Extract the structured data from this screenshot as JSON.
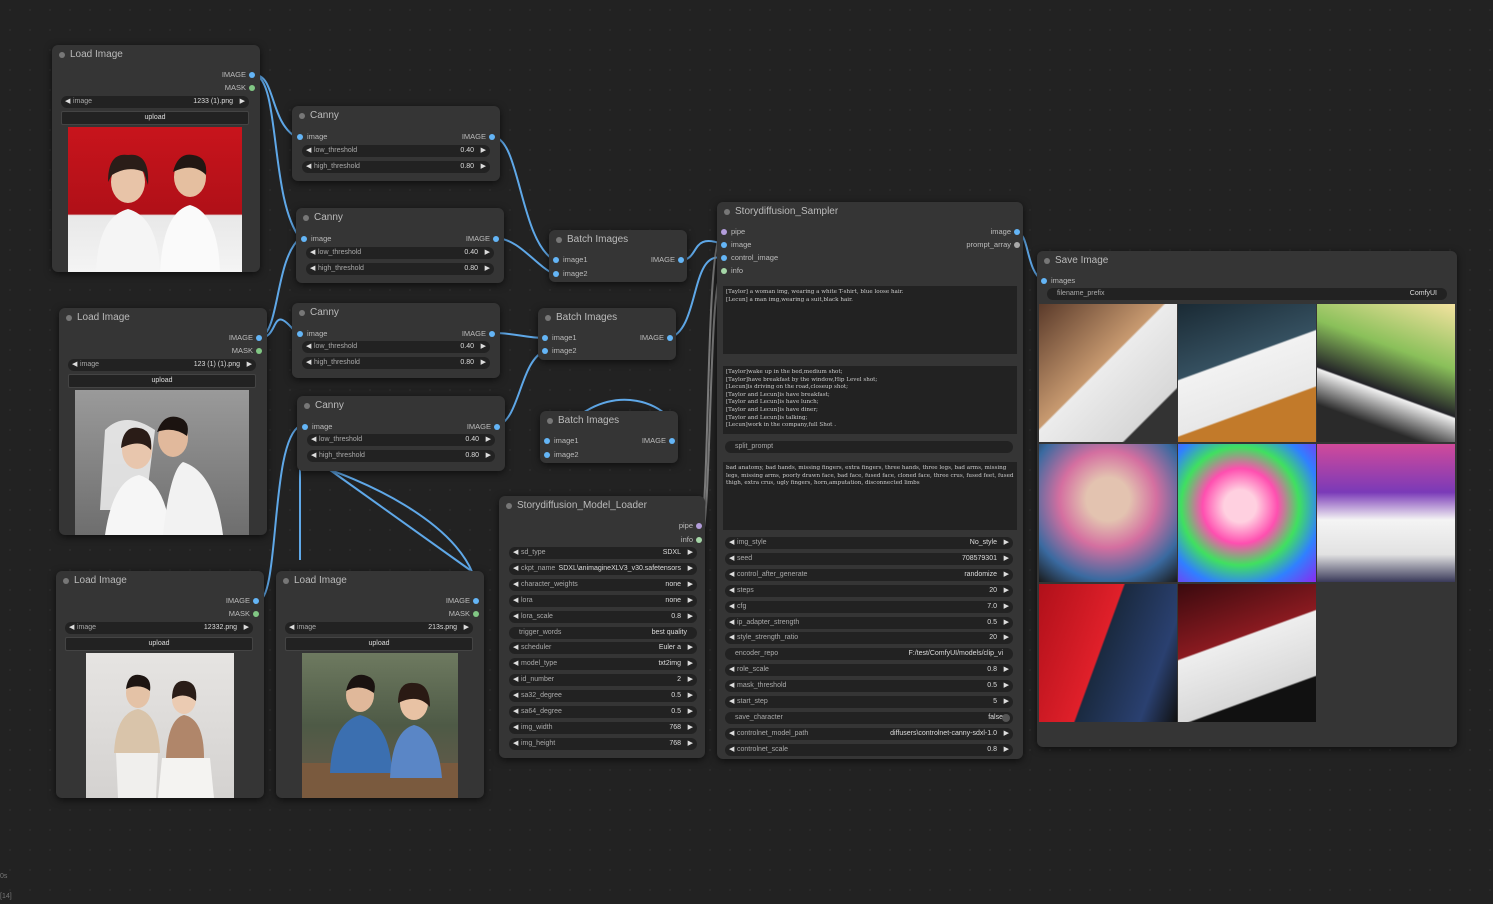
{
  "colors": {
    "image_port": "#64b5f6",
    "mask_port": "#81c784",
    "pipe_port": "#b39ddb",
    "info_port": "#a5d6a7",
    "link": "#64b5f6"
  },
  "load1": {
    "title": "Load Image",
    "out_image": "IMAGE",
    "out_mask": "MASK",
    "image_label": "image",
    "image_value": "1233 (1).png",
    "upload": "upload"
  },
  "load2": {
    "title": "Load Image",
    "out_image": "IMAGE",
    "out_mask": "MASK",
    "image_label": "image",
    "image_value": "123 (1) (1).png",
    "upload": "upload"
  },
  "load3": {
    "title": "Load Image",
    "out_image": "IMAGE",
    "out_mask": "MASK",
    "image_label": "image",
    "image_value": "12332.png",
    "upload": "upload"
  },
  "load4": {
    "title": "Load Image",
    "out_image": "IMAGE",
    "out_mask": "MASK",
    "image_label": "image",
    "image_value": "213s.png",
    "upload": "upload"
  },
  "canny1": {
    "title": "Canny",
    "in_image": "image",
    "out_image": "IMAGE",
    "low_label": "low_threshold",
    "low_value": "0.40",
    "high_label": "high_threshold",
    "high_value": "0.80"
  },
  "canny2": {
    "title": "Canny",
    "in_image": "image",
    "out_image": "IMAGE",
    "low_label": "low_threshold",
    "low_value": "0.40",
    "high_label": "high_threshold",
    "high_value": "0.80"
  },
  "canny3": {
    "title": "Canny",
    "in_image": "image",
    "out_image": "IMAGE",
    "low_label": "low_threshold",
    "low_value": "0.40",
    "high_label": "high_threshold",
    "high_value": "0.80"
  },
  "canny4": {
    "title": "Canny",
    "in_image": "image",
    "out_image": "IMAGE",
    "low_label": "low_threshold",
    "low_value": "0.40",
    "high_label": "high_threshold",
    "high_value": "0.80"
  },
  "batch1": {
    "title": "Batch Images",
    "in1": "image1",
    "in2": "image2",
    "out": "IMAGE"
  },
  "batch2": {
    "title": "Batch Images",
    "in1": "image1",
    "in2": "image2",
    "out": "IMAGE"
  },
  "batch3": {
    "title": "Batch Images",
    "in1": "image1",
    "in2": "image2",
    "out": "IMAGE"
  },
  "model_loader": {
    "title": "Storydiffusion_Model_Loader",
    "out_pipe": "pipe",
    "out_info": "info",
    "widgets": [
      {
        "label": "sd_type",
        "value": "SDXL"
      },
      {
        "label": "ckpt_name",
        "value": "SDXL\\animagineXLV3_v30.safetensors"
      },
      {
        "label": "character_weights",
        "value": "none"
      },
      {
        "label": "lora",
        "value": "none"
      },
      {
        "label": "lora_scale",
        "value": "0.8"
      },
      {
        "label": "trigger_words",
        "value": "best quality"
      },
      {
        "label": "scheduler",
        "value": "Euler a"
      },
      {
        "label": "model_type",
        "value": "txt2img"
      },
      {
        "label": "id_number",
        "value": "2"
      },
      {
        "label": "sa32_degree",
        "value": "0.5"
      },
      {
        "label": "sa64_degree",
        "value": "0.5"
      },
      {
        "label": "img_width",
        "value": "768"
      },
      {
        "label": "img_height",
        "value": "768"
      }
    ]
  },
  "sampler": {
    "title": "Storydiffusion_Sampler",
    "in_pipe": "pipe",
    "in_image": "image",
    "in_control": "control_image",
    "in_info": "info",
    "out_image": "image",
    "out_prompt": "prompt_array",
    "character_prompt": "[Taylor] a woman img, wearing a white T-shirt, blue loose hair.\n[Lecun] a man img,wearing a suit,black hair.",
    "scene_prompt": "[Taylor]wake up in the bed,medium shot;\n[Taylor]have breakfast by the window,Hip Level shot;\n[Lecun]is driving on the road,closeup shot;\n[Taylor and Lecun]is have breakfast;\n[Taylor and Lecun]is have lunch;\n[Taylor and Lecun]is have diner;\n[Taylor and Lecun]is talking;\n[Lecun]work in the company,full Shot .",
    "split_prompt": "split_prompt",
    "negative_prompt": "bad anatomy, bad hands, missing fingers, extra fingers, three hands, three legs, bad arms, missing legs, missing arms, poorly drawn face, bad face, fused face, cloned face, three crus, fused feet, fused thigh, extra crus, ugly fingers, horn,amputation, disconnected limbs",
    "widgets": [
      {
        "label": "img_style",
        "value": "No_style",
        "arrows": true
      },
      {
        "label": "seed",
        "value": "708579301",
        "arrows": true
      },
      {
        "label": "control_after_generate",
        "value": "randomize",
        "arrows": true
      },
      {
        "label": "steps",
        "value": "20",
        "arrows": true
      },
      {
        "label": "cfg",
        "value": "7.0",
        "arrows": true
      },
      {
        "label": "ip_adapter_strength",
        "value": "0.5",
        "arrows": true
      },
      {
        "label": "style_strength_ratio",
        "value": "20",
        "arrows": true
      },
      {
        "label": "encoder_repo",
        "value": "F:/test/ComfyUI/models/clip_vi",
        "arrows": false
      },
      {
        "label": "role_scale",
        "value": "0.8",
        "arrows": true
      },
      {
        "label": "mask_threshold",
        "value": "0.5",
        "arrows": true
      },
      {
        "label": "start_step",
        "value": "5",
        "arrows": true
      },
      {
        "label": "save_character",
        "value": "false",
        "arrows": false
      },
      {
        "label": "controlnet_model_path",
        "value": "diffusers\\controlnet-canny-sdxl-1.0",
        "arrows": true
      },
      {
        "label": "controlnet_scale",
        "value": "0.8",
        "arrows": true
      }
    ]
  },
  "save": {
    "title": "Save Image",
    "in_images": "images",
    "prefix_label": "filename_prefix",
    "prefix_value": "ComfyUI"
  },
  "corner": {
    "line1": "0s",
    "line2": "[14]"
  }
}
